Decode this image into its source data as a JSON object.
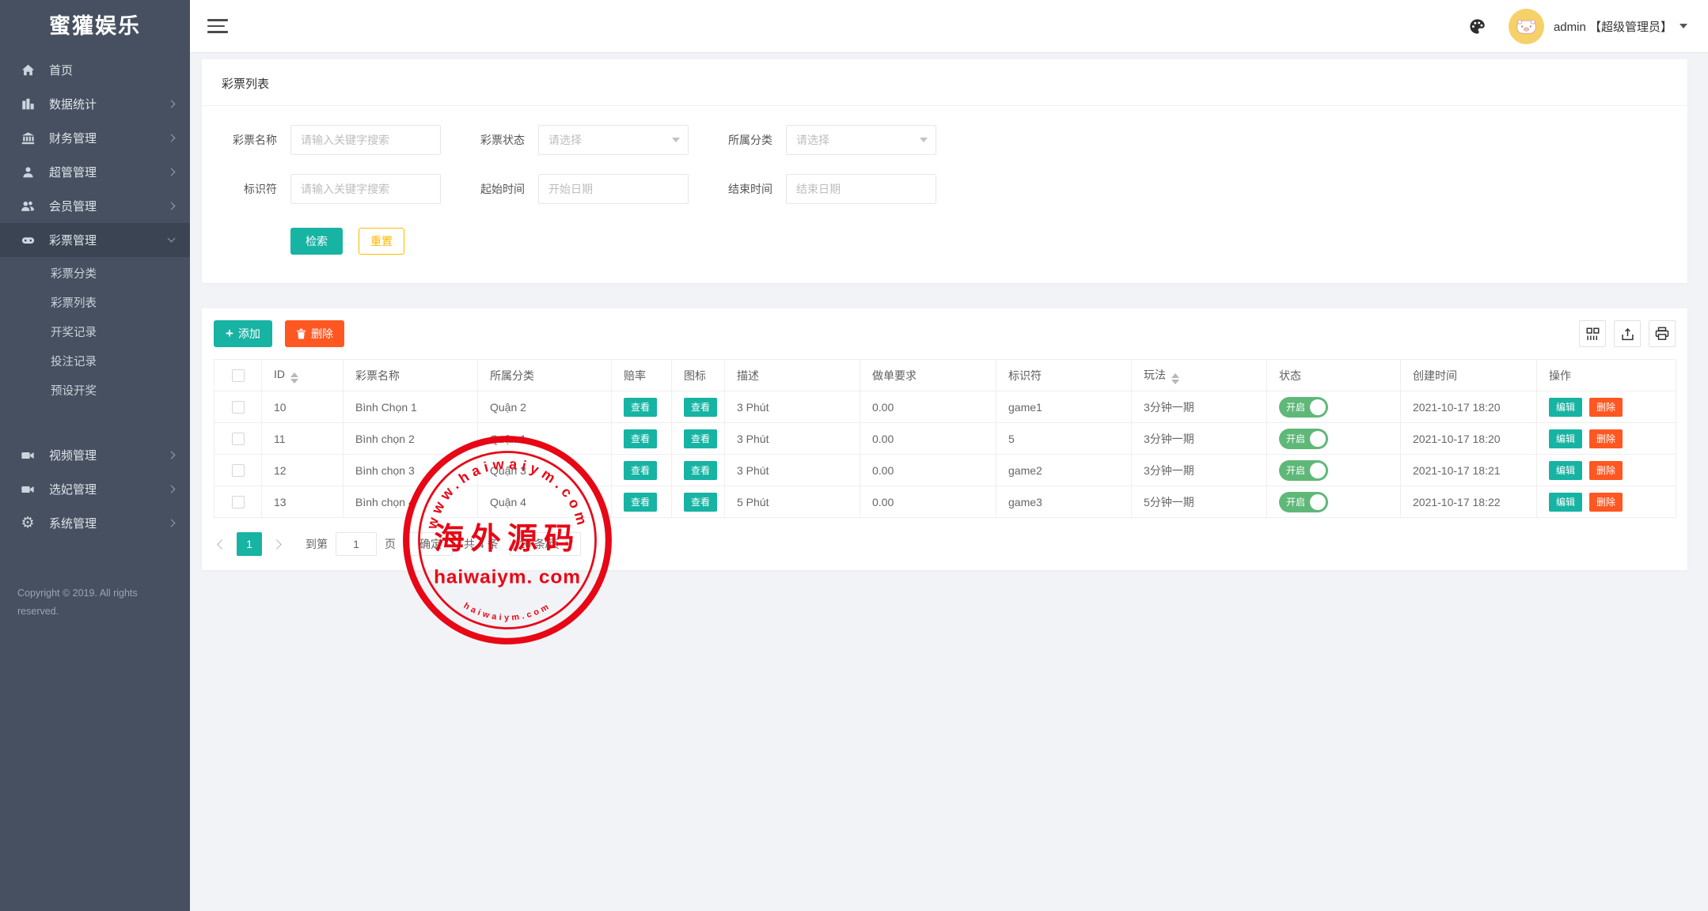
{
  "brand": {
    "name": "蜜獾娱乐"
  },
  "topbar": {
    "username": "admin 【超级管理员】"
  },
  "sidebar": {
    "items": [
      {
        "label": "首页"
      },
      {
        "label": "数据统计"
      },
      {
        "label": "财务管理"
      },
      {
        "label": "超管管理"
      },
      {
        "label": "会员管理"
      },
      {
        "label": "彩票管理"
      },
      {
        "label": "视频管理"
      },
      {
        "label": "选妃管理"
      },
      {
        "label": "系统管理"
      }
    ],
    "lottery_submenu": [
      {
        "label": "彩票分类"
      },
      {
        "label": "彩票列表"
      },
      {
        "label": "开奖记录"
      },
      {
        "label": "投注记录"
      },
      {
        "label": "预设开奖"
      }
    ],
    "copyright": "Copyright © 2019. All rights reserved."
  },
  "page": {
    "title": "彩票列表"
  },
  "filters": {
    "name_label": "彩票名称",
    "name_placeholder": "请输入关键字搜索",
    "status_label": "彩票状态",
    "status_placeholder": "请选择",
    "category_label": "所属分类",
    "category_placeholder": "请选择",
    "identifier_label": "标识符",
    "identifier_placeholder": "请输入关键字搜索",
    "start_label": "起始时间",
    "start_placeholder": "开始日期",
    "end_label": "结束时间",
    "end_placeholder": "结束日期",
    "search_button": "检索",
    "reset_button": "重置"
  },
  "table": {
    "add_button": "添加",
    "delete_button": "删除",
    "columns": [
      "ID",
      "彩票名称",
      "所属分类",
      "赔率",
      "图标",
      "描述",
      "做单要求",
      "标识符",
      "玩法",
      "状态",
      "创建时间",
      "操作"
    ],
    "view_button": "查看",
    "edit_button": "编辑",
    "row_delete_button": "删除",
    "rows": [
      {
        "id": "10",
        "name": "Bình Chọn 1",
        "category": "Quận 2",
        "desc": "3 Phút",
        "order_req": "0.00",
        "identifier": "game1",
        "play": "3分钟一期",
        "status": "开启",
        "created": "2021-10-17 18:20"
      },
      {
        "id": "11",
        "name": "Bình chọn 2",
        "category": "Quận 1",
        "desc": "3 Phút",
        "order_req": "0.00",
        "identifier": "5",
        "play": "3分钟一期",
        "status": "开启",
        "created": "2021-10-17 18:20"
      },
      {
        "id": "12",
        "name": "Bình chọn 3",
        "category": "Quận 3",
        "desc": "3 Phút",
        "order_req": "0.00",
        "identifier": "game2",
        "play": "3分钟一期",
        "status": "开启",
        "created": "2021-10-17 18:21"
      },
      {
        "id": "13",
        "name": "Bình chọn 4",
        "category": "Quận 4",
        "desc": "5 Phút",
        "order_req": "0.00",
        "identifier": "game3",
        "play": "5分钟一期",
        "status": "开启",
        "created": "2021-10-17 18:22"
      }
    ]
  },
  "pagination": {
    "page": "1",
    "goto_prefix": "到第",
    "goto_value": "1",
    "goto_suffix": "页",
    "confirm": "确定",
    "total": "共 4 条",
    "per_page": "10 条/页"
  },
  "watermark": {
    "top_text": "www.haiwaiym.com",
    "center_text": "海外源码",
    "domain_text": "haiwaiym. com",
    "bottom_text": "haiwaiym.com"
  },
  "colors": {
    "teal": "#17B3A3",
    "orange": "#FF5722",
    "yellow": "#FFB800",
    "toggle_green": "#5FB878",
    "stamp_red": "#E8000E",
    "sidebar_bg": "#465060"
  }
}
